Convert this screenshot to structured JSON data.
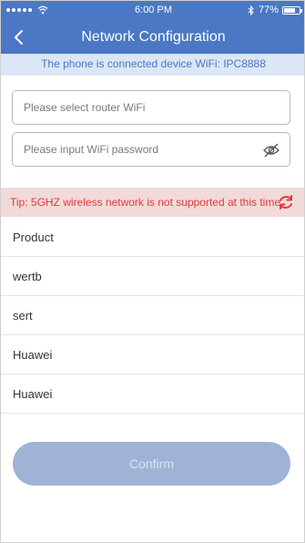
{
  "status_bar": {
    "time": "6:00 PM",
    "battery": "77%",
    "battery_level": 0.77,
    "icons": [
      "signal-dots-icon",
      "wifi-icon",
      "bluetooth-icon",
      "battery-icon"
    ]
  },
  "header": {
    "title": "Network Configuration",
    "back_icon": "chevron-left-icon"
  },
  "connection_info": "The phone is connected device WiFi: IPC8888",
  "form": {
    "router_placeholder": "Please select router WiFi",
    "password_placeholder": "Please input WiFi password",
    "password_toggle_icon": "eye-slash-icon"
  },
  "tip": {
    "text": "Tip: 5GHZ wireless network is not supported at this time",
    "refresh_icon": "refresh-icon"
  },
  "wifi_list": [
    "Product",
    "wertb",
    "sert",
    "Huawei",
    "Huawei"
  ],
  "confirm_label": "Confirm",
  "colors": {
    "primary": "#4a78c4",
    "banner_bg": "#dbe7f6",
    "tip_bg": "#f2dada",
    "tip_text": "#e23a3a",
    "button_disabled": "#9fb3d7"
  }
}
